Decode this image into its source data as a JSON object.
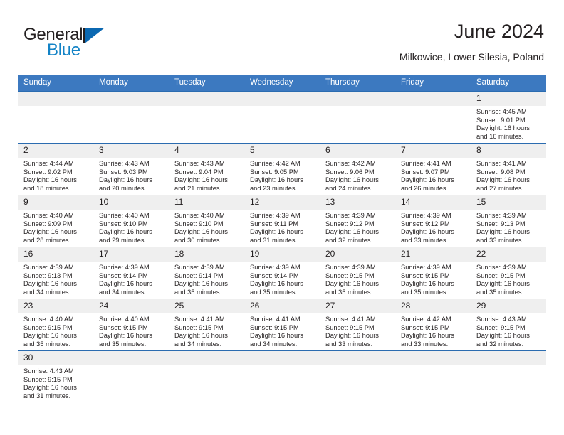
{
  "brand": {
    "name_top": "General",
    "name_bottom": "Blue",
    "flag_icon": "blue-triangle-flag-icon",
    "colors": {
      "dark": "#231f20",
      "blue": "#1383c6",
      "flag": "#0b68b1"
    }
  },
  "header": {
    "title": "June 2024",
    "subtitle": "Milkowice, Lower Silesia, Poland"
  },
  "theme": {
    "header_blue": "#3c79c0",
    "row_rule_blue": "#2b6cb0",
    "daynum_band": "#efefef",
    "text": "#231f20"
  },
  "weekdays": [
    "Sunday",
    "Monday",
    "Tuesday",
    "Wednesday",
    "Thursday",
    "Friday",
    "Saturday"
  ],
  "labels": {
    "sunrise": "Sunrise:",
    "sunset": "Sunset:",
    "daylight": "Daylight:"
  },
  "weeks": [
    [
      {
        "day": "",
        "sunrise": "",
        "sunset": "",
        "daylight_line1": "",
        "daylight_line2": ""
      },
      {
        "day": "",
        "sunrise": "",
        "sunset": "",
        "daylight_line1": "",
        "daylight_line2": ""
      },
      {
        "day": "",
        "sunrise": "",
        "sunset": "",
        "daylight_line1": "",
        "daylight_line2": ""
      },
      {
        "day": "",
        "sunrise": "",
        "sunset": "",
        "daylight_line1": "",
        "daylight_line2": ""
      },
      {
        "day": "",
        "sunrise": "",
        "sunset": "",
        "daylight_line1": "",
        "daylight_line2": ""
      },
      {
        "day": "",
        "sunrise": "",
        "sunset": "",
        "daylight_line1": "",
        "daylight_line2": ""
      },
      {
        "day": "1",
        "sunrise": "Sunrise: 4:45 AM",
        "sunset": "Sunset: 9:01 PM",
        "daylight_line1": "Daylight: 16 hours",
        "daylight_line2": "and 16 minutes."
      }
    ],
    [
      {
        "day": "2",
        "sunrise": "Sunrise: 4:44 AM",
        "sunset": "Sunset: 9:02 PM",
        "daylight_line1": "Daylight: 16 hours",
        "daylight_line2": "and 18 minutes."
      },
      {
        "day": "3",
        "sunrise": "Sunrise: 4:43 AM",
        "sunset": "Sunset: 9:03 PM",
        "daylight_line1": "Daylight: 16 hours",
        "daylight_line2": "and 20 minutes."
      },
      {
        "day": "4",
        "sunrise": "Sunrise: 4:43 AM",
        "sunset": "Sunset: 9:04 PM",
        "daylight_line1": "Daylight: 16 hours",
        "daylight_line2": "and 21 minutes."
      },
      {
        "day": "5",
        "sunrise": "Sunrise: 4:42 AM",
        "sunset": "Sunset: 9:05 PM",
        "daylight_line1": "Daylight: 16 hours",
        "daylight_line2": "and 23 minutes."
      },
      {
        "day": "6",
        "sunrise": "Sunrise: 4:42 AM",
        "sunset": "Sunset: 9:06 PM",
        "daylight_line1": "Daylight: 16 hours",
        "daylight_line2": "and 24 minutes."
      },
      {
        "day": "7",
        "sunrise": "Sunrise: 4:41 AM",
        "sunset": "Sunset: 9:07 PM",
        "daylight_line1": "Daylight: 16 hours",
        "daylight_line2": "and 26 minutes."
      },
      {
        "day": "8",
        "sunrise": "Sunrise: 4:41 AM",
        "sunset": "Sunset: 9:08 PM",
        "daylight_line1": "Daylight: 16 hours",
        "daylight_line2": "and 27 minutes."
      }
    ],
    [
      {
        "day": "9",
        "sunrise": "Sunrise: 4:40 AM",
        "sunset": "Sunset: 9:09 PM",
        "daylight_line1": "Daylight: 16 hours",
        "daylight_line2": "and 28 minutes."
      },
      {
        "day": "10",
        "sunrise": "Sunrise: 4:40 AM",
        "sunset": "Sunset: 9:10 PM",
        "daylight_line1": "Daylight: 16 hours",
        "daylight_line2": "and 29 minutes."
      },
      {
        "day": "11",
        "sunrise": "Sunrise: 4:40 AM",
        "sunset": "Sunset: 9:10 PM",
        "daylight_line1": "Daylight: 16 hours",
        "daylight_line2": "and 30 minutes."
      },
      {
        "day": "12",
        "sunrise": "Sunrise: 4:39 AM",
        "sunset": "Sunset: 9:11 PM",
        "daylight_line1": "Daylight: 16 hours",
        "daylight_line2": "and 31 minutes."
      },
      {
        "day": "13",
        "sunrise": "Sunrise: 4:39 AM",
        "sunset": "Sunset: 9:12 PM",
        "daylight_line1": "Daylight: 16 hours",
        "daylight_line2": "and 32 minutes."
      },
      {
        "day": "14",
        "sunrise": "Sunrise: 4:39 AM",
        "sunset": "Sunset: 9:12 PM",
        "daylight_line1": "Daylight: 16 hours",
        "daylight_line2": "and 33 minutes."
      },
      {
        "day": "15",
        "sunrise": "Sunrise: 4:39 AM",
        "sunset": "Sunset: 9:13 PM",
        "daylight_line1": "Daylight: 16 hours",
        "daylight_line2": "and 33 minutes."
      }
    ],
    [
      {
        "day": "16",
        "sunrise": "Sunrise: 4:39 AM",
        "sunset": "Sunset: 9:13 PM",
        "daylight_line1": "Daylight: 16 hours",
        "daylight_line2": "and 34 minutes."
      },
      {
        "day": "17",
        "sunrise": "Sunrise: 4:39 AM",
        "sunset": "Sunset: 9:14 PM",
        "daylight_line1": "Daylight: 16 hours",
        "daylight_line2": "and 34 minutes."
      },
      {
        "day": "18",
        "sunrise": "Sunrise: 4:39 AM",
        "sunset": "Sunset: 9:14 PM",
        "daylight_line1": "Daylight: 16 hours",
        "daylight_line2": "and 35 minutes."
      },
      {
        "day": "19",
        "sunrise": "Sunrise: 4:39 AM",
        "sunset": "Sunset: 9:14 PM",
        "daylight_line1": "Daylight: 16 hours",
        "daylight_line2": "and 35 minutes."
      },
      {
        "day": "20",
        "sunrise": "Sunrise: 4:39 AM",
        "sunset": "Sunset: 9:15 PM",
        "daylight_line1": "Daylight: 16 hours",
        "daylight_line2": "and 35 minutes."
      },
      {
        "day": "21",
        "sunrise": "Sunrise: 4:39 AM",
        "sunset": "Sunset: 9:15 PM",
        "daylight_line1": "Daylight: 16 hours",
        "daylight_line2": "and 35 minutes."
      },
      {
        "day": "22",
        "sunrise": "Sunrise: 4:39 AM",
        "sunset": "Sunset: 9:15 PM",
        "daylight_line1": "Daylight: 16 hours",
        "daylight_line2": "and 35 minutes."
      }
    ],
    [
      {
        "day": "23",
        "sunrise": "Sunrise: 4:40 AM",
        "sunset": "Sunset: 9:15 PM",
        "daylight_line1": "Daylight: 16 hours",
        "daylight_line2": "and 35 minutes."
      },
      {
        "day": "24",
        "sunrise": "Sunrise: 4:40 AM",
        "sunset": "Sunset: 9:15 PM",
        "daylight_line1": "Daylight: 16 hours",
        "daylight_line2": "and 35 minutes."
      },
      {
        "day": "25",
        "sunrise": "Sunrise: 4:41 AM",
        "sunset": "Sunset: 9:15 PM",
        "daylight_line1": "Daylight: 16 hours",
        "daylight_line2": "and 34 minutes."
      },
      {
        "day": "26",
        "sunrise": "Sunrise: 4:41 AM",
        "sunset": "Sunset: 9:15 PM",
        "daylight_line1": "Daylight: 16 hours",
        "daylight_line2": "and 34 minutes."
      },
      {
        "day": "27",
        "sunrise": "Sunrise: 4:41 AM",
        "sunset": "Sunset: 9:15 PM",
        "daylight_line1": "Daylight: 16 hours",
        "daylight_line2": "and 33 minutes."
      },
      {
        "day": "28",
        "sunrise": "Sunrise: 4:42 AM",
        "sunset": "Sunset: 9:15 PM",
        "daylight_line1": "Daylight: 16 hours",
        "daylight_line2": "and 33 minutes."
      },
      {
        "day": "29",
        "sunrise": "Sunrise: 4:43 AM",
        "sunset": "Sunset: 9:15 PM",
        "daylight_line1": "Daylight: 16 hours",
        "daylight_line2": "and 32 minutes."
      }
    ],
    [
      {
        "day": "30",
        "sunrise": "Sunrise: 4:43 AM",
        "sunset": "Sunset: 9:15 PM",
        "daylight_line1": "Daylight: 16 hours",
        "daylight_line2": "and 31 minutes."
      },
      {
        "day": "",
        "sunrise": "",
        "sunset": "",
        "daylight_line1": "",
        "daylight_line2": ""
      },
      {
        "day": "",
        "sunrise": "",
        "sunset": "",
        "daylight_line1": "",
        "daylight_line2": ""
      },
      {
        "day": "",
        "sunrise": "",
        "sunset": "",
        "daylight_line1": "",
        "daylight_line2": ""
      },
      {
        "day": "",
        "sunrise": "",
        "sunset": "",
        "daylight_line1": "",
        "daylight_line2": ""
      },
      {
        "day": "",
        "sunrise": "",
        "sunset": "",
        "daylight_line1": "",
        "daylight_line2": ""
      },
      {
        "day": "",
        "sunrise": "",
        "sunset": "",
        "daylight_line1": "",
        "daylight_line2": ""
      }
    ]
  ]
}
